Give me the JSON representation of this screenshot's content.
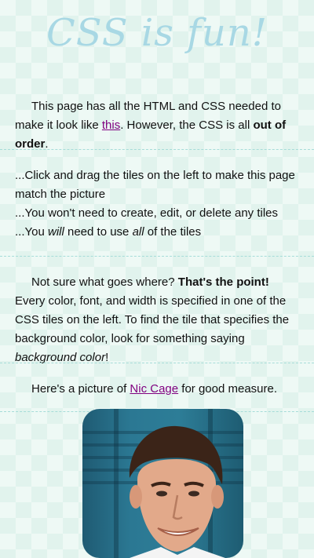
{
  "title": "CSS is fun!",
  "intro": {
    "text_before": "This page has all the HTML and CSS needed to make it look like ",
    "link": "this",
    "text_middle": ". However, the CSS is all ",
    "bold": "out of order",
    "text_end": "."
  },
  "instructions": {
    "line1": "...Click and drag the tiles on the left to make this page match the picture",
    "line2": "...You won't need to create, edit, or delete any tiles",
    "line3_a": "...You ",
    "line3_will": "will",
    "line3_b": " need to use ",
    "line3_all": "all",
    "line3_c": " of the tiles"
  },
  "hint": {
    "text_a": "Not sure what goes where? ",
    "bold": "That's the point!",
    "text_b": " Every color, font, and width is specified in one of the CSS tiles on the left. To find the tile that specifies the background color, look for something saying ",
    "italic": "background color",
    "text_c": "!"
  },
  "picture": {
    "text_before": "Here's a picture of ",
    "link": "Nic Cage",
    "text_after": " for good measure."
  },
  "colors": {
    "background": "#eef9f5",
    "title": "#a8d8e4",
    "link": "#800080",
    "divider": "#a6dcd8"
  }
}
